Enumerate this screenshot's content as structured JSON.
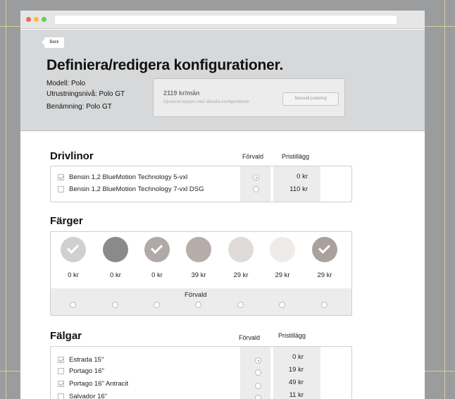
{
  "header": {
    "back_label": "Back",
    "title": "Definiera/redigera konfigurationer.",
    "model": "Modell:  Polo",
    "equipment": "Utrustningsnivå:  Polo GT",
    "name": "Benämning:  Polo GT",
    "price_main": "2119 kr/mån",
    "price_sub": "Ojusterat baspris med aktuella konfigurationer",
    "adjust_label": "Manuell justering"
  },
  "drivlinor": {
    "title": "Drivlinor",
    "col_default": "Förvald",
    "col_price": "Pristillägg",
    "rows": [
      {
        "label": "Bensin 1,2 BlueMotion Technology 5-vxl",
        "checked": true,
        "default": true,
        "price": "0 kr"
      },
      {
        "label": "Bensin 1,2 BlueMotion Technology 7-vxl DSG",
        "checked": false,
        "default": false,
        "price": "110 kr"
      }
    ]
  },
  "farger": {
    "title": "Färger",
    "default_label": "Förvald",
    "swatches": [
      {
        "color": "#d0d0d0",
        "checked": true,
        "price": "0 kr"
      },
      {
        "color": "#8a8a8a",
        "checked": false,
        "price": "0 kr"
      },
      {
        "color": "#b1a9a8",
        "checked": true,
        "price": "0 kr"
      },
      {
        "color": "#b6adab",
        "checked": false,
        "price": "39 kr"
      },
      {
        "color": "#e0dbd9",
        "checked": false,
        "price": "29 kr"
      },
      {
        "color": "#efebe9",
        "checked": false,
        "price": "29 kr"
      },
      {
        "color": "#aaa19f",
        "checked": true,
        "price": "29 kr"
      }
    ]
  },
  "falgar": {
    "title": "Fälgar",
    "col_default": "Förvald",
    "col_price": "Pristillägg",
    "rows": [
      {
        "label": "Estrada 15\"",
        "checked": true,
        "default": true,
        "price": "0 kr"
      },
      {
        "label": "Portago 16\"",
        "checked": false,
        "default": false,
        "price": "19 kr"
      },
      {
        "label": "Portago 16\" Antracit",
        "checked": true,
        "default": false,
        "price": "49 kr"
      },
      {
        "label": "Salvador 16\"",
        "checked": false,
        "default": false,
        "price": "11 kr"
      }
    ]
  }
}
